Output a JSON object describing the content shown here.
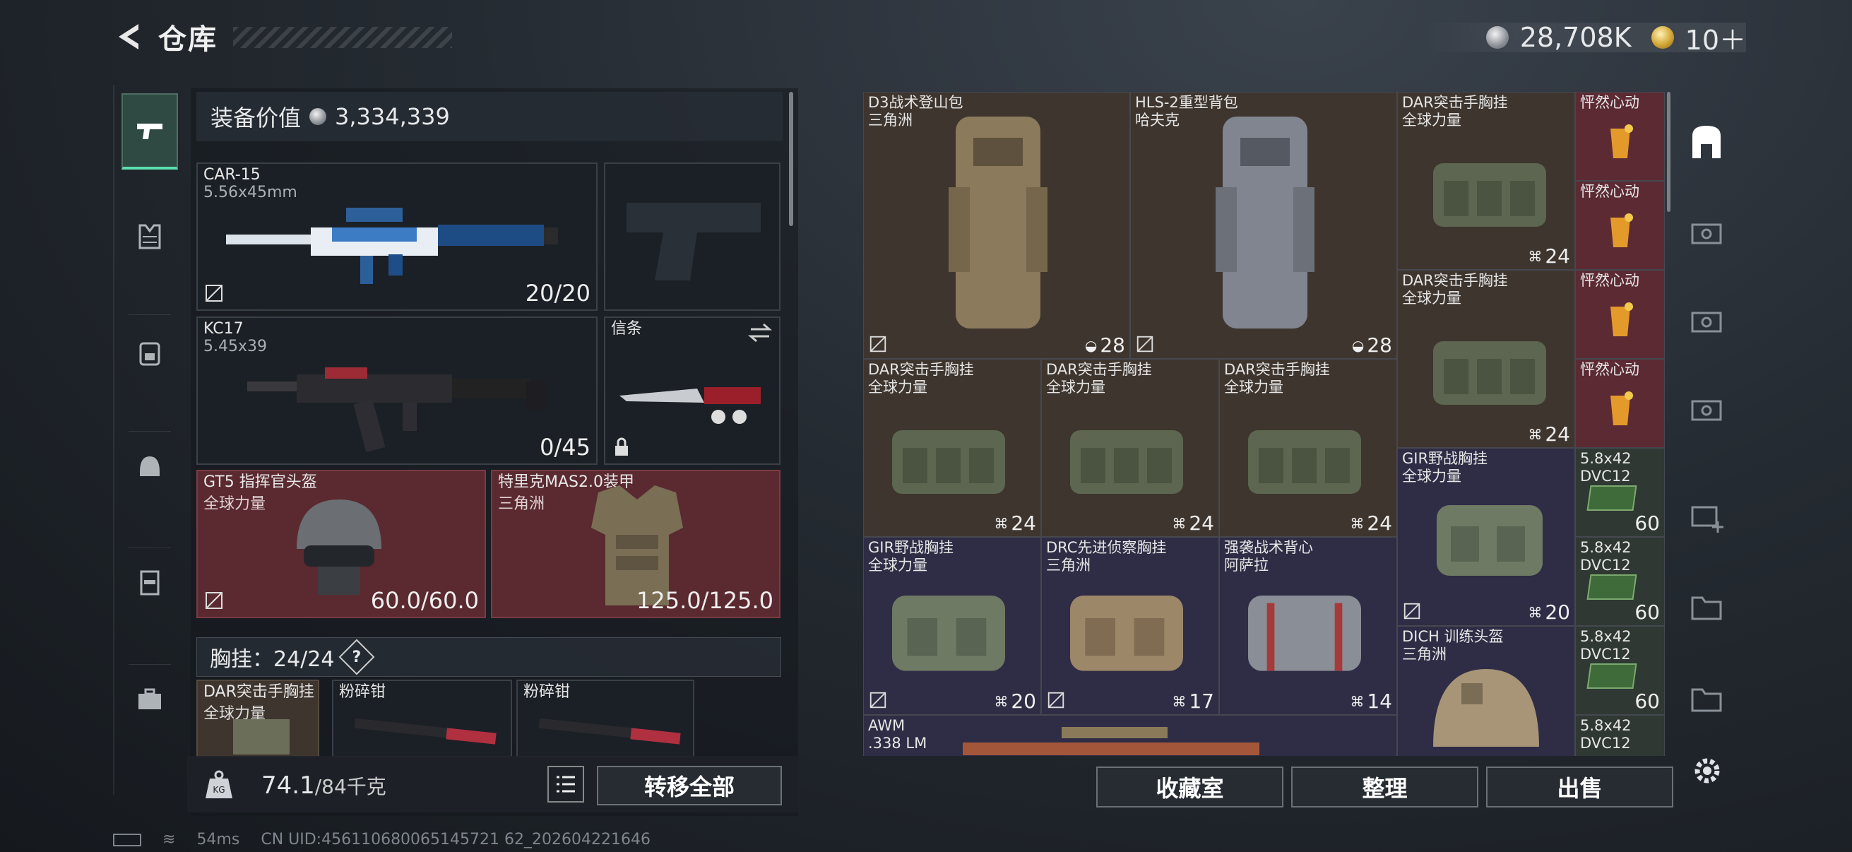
{
  "header": {
    "title": "仓库",
    "currency_silver": "28,708K",
    "currency_gold": "10＋"
  },
  "left_nav": {
    "items": [
      "weapon-icon",
      "armor-icon",
      "backpack-icon",
      "helmet-icon",
      "chest-rig-icon",
      "case-icon"
    ]
  },
  "equipment": {
    "value_label": "装备价值",
    "value": "3,334,339",
    "primary": {
      "name": "CAR-15",
      "caliber": "5.56x45mm",
      "ammo": "20/20"
    },
    "secondary": {
      "name": "KC17",
      "caliber": "5.45x39",
      "ammo": "0/45"
    },
    "melee": {
      "name": "信条"
    },
    "helmet": {
      "name": "GT5 指挥官头盔",
      "faction": "全球力量",
      "durability": "60.0/60.0"
    },
    "armor": {
      "name": "特里克MAS2.0装甲",
      "faction": "三角洲",
      "durability": "125.0/125.0"
    },
    "chest": {
      "label": "胸挂：",
      "capacity": "24/24",
      "help": "?"
    },
    "chest_items": [
      {
        "name": "DAR突击手胸挂",
        "faction": "全球力量"
      },
      {
        "name": "粉碎钳"
      },
      {
        "name": "粉碎钳"
      }
    ],
    "weight": "74.1",
    "weight_max": "/84千克",
    "transfer_all": "转移全部"
  },
  "storage": {
    "items": [
      {
        "name": "D3战术登山包",
        "faction": "三角洲",
        "cap": "28"
      },
      {
        "name": "HLS-2重型背包",
        "faction": "哈夫克",
        "cap": "28"
      },
      {
        "name": "DAR突击手胸挂",
        "faction": "全球力量",
        "cap": "24"
      },
      {
        "name": "怦然心动"
      },
      {
        "name": "怦然心动"
      },
      {
        "name": "DAR突击手胸挂",
        "faction": "全球力量",
        "cap": "24"
      },
      {
        "name": "怦然心动"
      },
      {
        "name": "怦然心动"
      },
      {
        "name": "DAR突击手胸挂",
        "faction": "全球力量",
        "cap": "24"
      },
      {
        "name": "DAR突击手胸挂",
        "faction": "全球力量",
        "cap": "24"
      },
      {
        "name": "DAR突击手胸挂",
        "faction": "全球力量",
        "cap": "24"
      },
      {
        "name": "GIR野战胸挂",
        "faction": "全球力量",
        "cap": "20"
      },
      {
        "name": "5.8x42",
        "sub": "DVC12",
        "cnt": "60"
      },
      {
        "name": "5.8x42",
        "sub": "DVC12",
        "cnt": "60"
      },
      {
        "name": "GIR野战胸挂",
        "faction": "全球力量",
        "cap": "20"
      },
      {
        "name": "DRC先进侦察胸挂",
        "faction": "三角洲",
        "cap": "17"
      },
      {
        "name": "强袭战术背心",
        "faction": "阿萨拉",
        "cap": "14"
      },
      {
        "name": "5.8x42",
        "sub": "DVC12",
        "cnt": "60"
      },
      {
        "name": "DICH 训练头盔",
        "faction": "三角洲"
      },
      {
        "name": "5.8x42",
        "sub": "DVC12"
      },
      {
        "name": "AWM",
        "sub": ".338 LM"
      }
    ],
    "buttons": {
      "collection": "收藏室",
      "sort": "整理",
      "sell": "出售"
    }
  },
  "status": {
    "ping": "54ms",
    "uid": "CN UID:456110680065145721 62_202604221646"
  },
  "colors": {
    "accent": "#5de0b0",
    "red_slot": "#5a2a30",
    "wine": "#5c2a33"
  }
}
